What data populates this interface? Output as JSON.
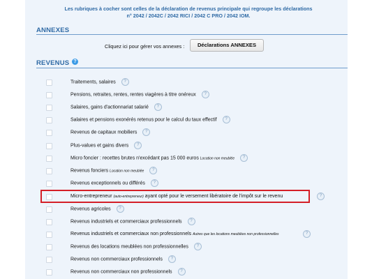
{
  "intro": {
    "line1": "Les rubriques à cocher sont celles de la déclaration de revenus principale qui regroupe les déclarations",
    "line2": "n° 2042 / 2042C / 2042 RICI / 2042 C PRO / 2042 IOM."
  },
  "annexes": {
    "title": "ANNEXES",
    "manage_text": "Cliquez ici pour gérer vos annexes :",
    "button_label": "Déclarations ANNEXES"
  },
  "revenus": {
    "title": "REVENUS",
    "help_glyph": "?",
    "items": [
      {
        "label": "Traitements, salaires",
        "note": ""
      },
      {
        "label": "Pensions, retraites, rentes, rentes viagères à titre onéreux",
        "note": ""
      },
      {
        "label": "Salaires, gains d'actionnariat salarié",
        "note": ""
      },
      {
        "label": "Salaires et pensions exonérés retenus pour le calcul du taux effectif",
        "note": ""
      },
      {
        "label": "Revenus de capitaux mobiliers",
        "note": ""
      },
      {
        "label": "Plus-values et gains divers",
        "note": ""
      },
      {
        "label": "Micro foncier : recettes brutes n'excédant pas 15 000 euros",
        "note": "Location non meublée"
      },
      {
        "label": "Revenus fonciers",
        "note": "Location non meublée"
      },
      {
        "label": "Revenus exceptionnels ou différés",
        "note": ""
      },
      {
        "label": "Micro-entrepreneur",
        "note": "(auto-entrepreneur)",
        "label_after": "ayant opté pour le versement libératoire de l'impôt sur le revenu"
      },
      {
        "label": "Revenus agricoles",
        "note": ""
      },
      {
        "label": "Revenus industriels et commerciaux professionnels",
        "note": ""
      },
      {
        "label": "Revenus industriels et commerciaux non professionnels",
        "note": "Autres que les locations meublées non professionnelles"
      },
      {
        "label": "Revenus des locations meublées non professionnelles",
        "note": ""
      },
      {
        "label": "Revenus non commerciaux professionnels",
        "note": ""
      },
      {
        "label": "Revenus non commerciaux non professionnels",
        "note": ""
      }
    ]
  },
  "colors": {
    "title_blue": "#2f6aa5",
    "highlight_red": "#d41f27",
    "panel_bg": "#eef4fb"
  }
}
